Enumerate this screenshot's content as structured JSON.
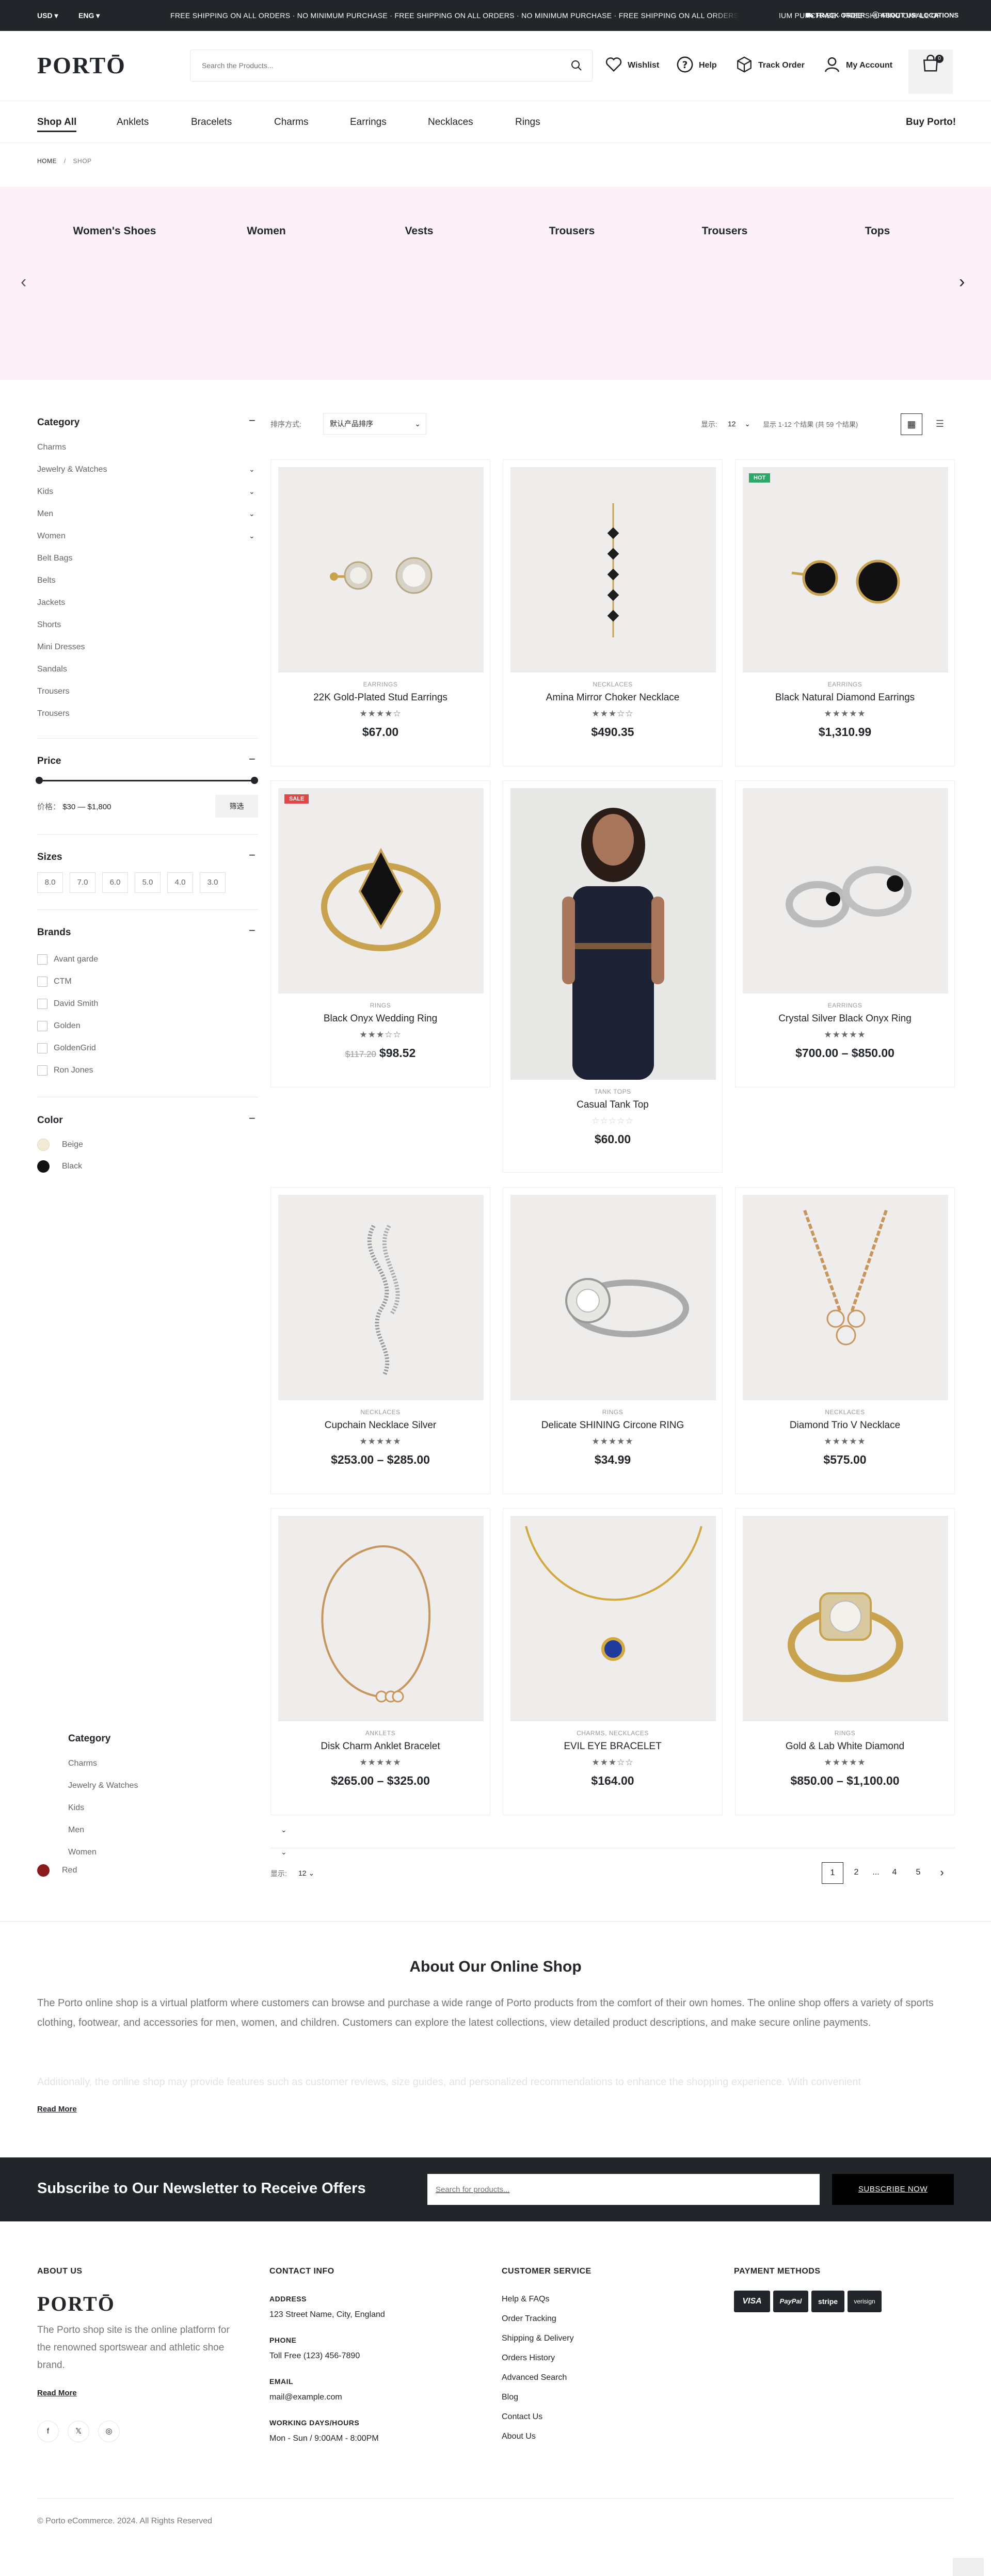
{
  "topbar": {
    "currency": "USD",
    "language": "ENG",
    "marquee": "FREE SHIPPING ON ALL ORDERS · NO MINIMUM PURCHASE · FREE SHIPPING ON ALL ORDERS · NO MINIMUM PURCHASE · FREE SHIPPING ON ALL ORDERS · NO MINIMUM PURCHASE · FREE SHIPPING ON ALL ORDERS · NO MINIMUM PURCHASE",
    "util_left": "TRACK ORDER",
    "util_mid": "ABOUT US",
    "util_right": "LOCATIONS"
  },
  "header": {
    "logo": "PORTŌ",
    "search_placeholder": "Search the Products...",
    "wishlist": "Wishlist",
    "help": "Help",
    "track": "Track Order",
    "account": "My Account",
    "cart_count": "0"
  },
  "nav": {
    "items": [
      "Shop All",
      "Anklets",
      "Bracelets",
      "Charms",
      "Earrings",
      "Necklaces",
      "Rings"
    ],
    "right": "Buy Porto!"
  },
  "breadcrumb": {
    "home": "HOME",
    "sep": "/",
    "current": "SHOP"
  },
  "banner": {
    "categories": [
      "Women's Shoes",
      "Women",
      "Vests",
      "Trousers",
      "Trousers",
      "Tops"
    ]
  },
  "sidebar": {
    "category_title": "Category",
    "categories": [
      "Charms",
      "Jewelry & Watches",
      "Kids",
      "Men",
      "Women",
      "Belt Bags",
      "Belts",
      "Jackets",
      "Shorts",
      "Mini Dresses",
      "Sandals",
      "Trousers",
      "Trousers"
    ],
    "price_title": "Price",
    "price_label": "价格：",
    "price_range": "$30 — $1,800",
    "filter_button": "筛选",
    "sizes_title": "Sizes",
    "sizes": [
      "8.0",
      "7.0",
      "6.0",
      "5.0",
      "4.0",
      "3.0"
    ],
    "brands_title": "Brands",
    "brands": [
      "Avant garde",
      "CTM",
      "David Smith",
      "Golden",
      "GoldenGrid",
      "Ron Jones"
    ],
    "color_title": "Color",
    "colors": [
      {
        "name": "Beige",
        "hex": "#f3ead6"
      },
      {
        "name": "Black",
        "hex": "#111111"
      }
    ]
  },
  "overlay_sidebar": {
    "category_title": "Category",
    "categories": [
      "Charms",
      "Jewelry & Watches",
      "Kids",
      "Men",
      "Women"
    ],
    "color": {
      "name": "Red",
      "hex": "#8b1a1a"
    }
  },
  "toolbar": {
    "sort_label": "排序方式:",
    "sort_value": "默认产品排序",
    "show_label": "显示:",
    "show_value": "12",
    "results": "显示 1-12 个结果 (共 59 个结果)"
  },
  "products": [
    {
      "cat": "EARRINGS",
      "name": "22K Gold-Plated Stud Earrings",
      "stars": "★★★★☆",
      "price": "$67.00"
    },
    {
      "cat": "NECKLACES",
      "name": "Amina Mirror Choker Necklace",
      "stars": "★★★☆☆",
      "price": "$490.35"
    },
    {
      "cat": "EARRINGS",
      "name": "Black Natural Diamond Earrings",
      "stars": "★★★★★",
      "price": "$1,310.99",
      "badge": "HOT"
    },
    {
      "cat": "RINGS",
      "name": "Black Onyx Wedding Ring",
      "stars": "★★★☆☆",
      "old_price": "$117.20",
      "price": "$98.52",
      "badge": "SALE"
    },
    {
      "cat": "TANK TOPS",
      "name": "Casual Tank Top",
      "stars": "☆☆☆☆☆",
      "price": "$60.00"
    },
    {
      "cat": "EARRINGS",
      "name": "Crystal Silver Black Onyx Ring",
      "stars": "★★★★★",
      "price": "$700.00 – $850.00"
    },
    {
      "cat": "NECKLACES",
      "name": "Cupchain Necklace Silver",
      "stars": "★★★★★",
      "price": "$253.00 – $285.00"
    },
    {
      "cat": "RINGS",
      "name": "Delicate SHINING Circone RING",
      "stars": "★★★★★",
      "price": "$34.99"
    },
    {
      "cat": "NECKLACES",
      "name": "Diamond Trio V Necklace",
      "stars": "★★★★★",
      "price": "$575.00"
    },
    {
      "cat": "ANKLETS",
      "name": "Disk Charm Anklet Bracelet",
      "stars": "★★★★★",
      "price": "$265.00 – $325.00"
    },
    {
      "cat": "CHARMS, NECKLACES",
      "name": "EVIL EYE BRACELET",
      "stars": "★★★☆☆",
      "price": "$164.00"
    },
    {
      "cat": "RINGS",
      "name": "Gold & Lab White Diamond",
      "stars": "★★★★★",
      "price": "$850.00 – $1,100.00"
    }
  ],
  "pagination": {
    "show_label": "显示:",
    "show_value": "12",
    "pages": [
      "1",
      "2",
      "...",
      "4",
      "5"
    ],
    "next": "›"
  },
  "about": {
    "title": "About Our Online Shop",
    "p1": "The Porto online shop is a virtual platform where customers can browse and purchase a wide range of Porto products from the comfort of their own homes. The online shop offers a variety of sports clothing, footwear, and accessories for men, women, and children. Customers can explore the latest collections, view detailed product descriptions, and make secure online payments.",
    "p2": "Additionally, the online shop may provide features such as customer reviews, size guides, and personalized recommendations to enhance the shopping experience. With convenient",
    "read_more": "Read More"
  },
  "newsletter": {
    "title": "Subscribe to Our Newsletter to Receive Offers",
    "placeholder": "Search for products...",
    "button": "SUBSCRIBE NOW"
  },
  "footer": {
    "about_title": "ABOUT US",
    "logo": "PORTŌ",
    "about_text": "The Porto shop site is the online platform for the renowned sportswear and athletic shoe brand.",
    "read_more": "Read More",
    "contact_title": "CONTACT INFO",
    "address_label": "ADDRESS",
    "address": "123 Street Name, City, England",
    "phone_label": "PHONE",
    "phone": "Toll Free (123) 456-7890",
    "email_label": "EMAIL",
    "email": "mail@example.com",
    "hours_label": "WORKING DAYS/HOURS",
    "hours": "Mon - Sun / 9:00AM - 8:00PM",
    "service_title": "CUSTOMER SERVICE",
    "service_links": [
      "Help & FAQs",
      "Order Tracking",
      "Shipping & Delivery",
      "Orders History",
      "Advanced Search",
      "Blog",
      "Contact Us",
      "About Us"
    ],
    "payment_title": "PAYMENT METHODS",
    "payments": [
      "VISA",
      "PayPal",
      "stripe",
      "verisign"
    ],
    "copyright": "© Porto eCommerce. 2024. All Rights Reserved"
  }
}
